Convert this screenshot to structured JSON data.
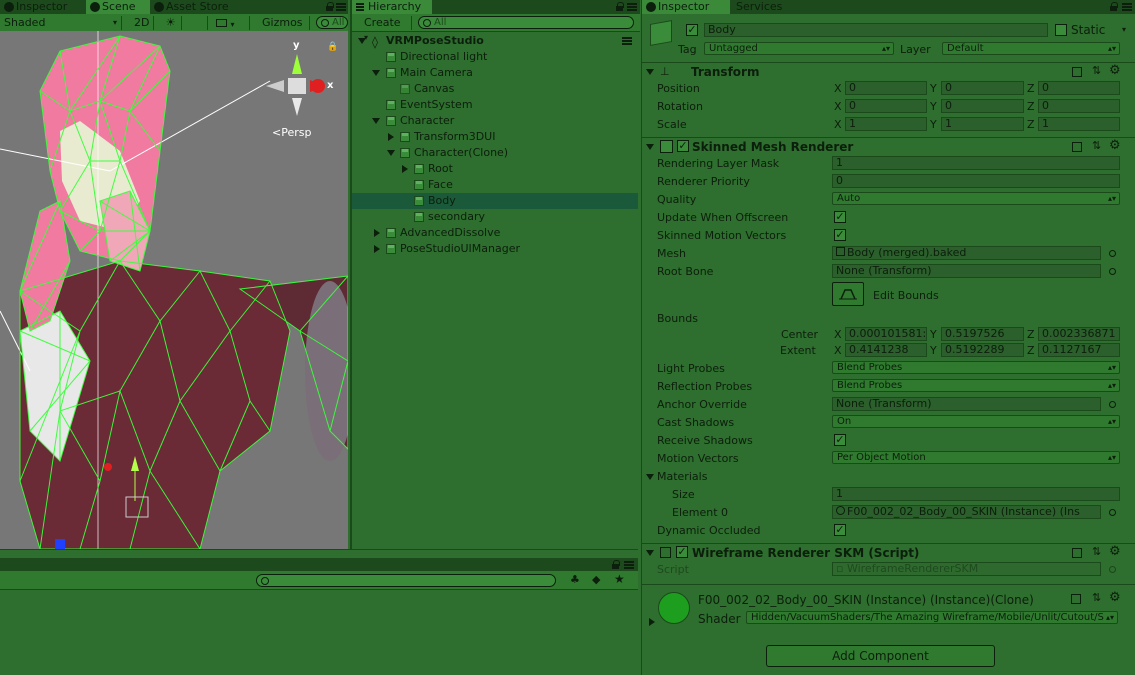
{
  "scene_panel": {
    "tabs": [
      {
        "label": "Inspector"
      },
      {
        "label": "Scene"
      },
      {
        "label": "Asset Store"
      }
    ],
    "toolbar": {
      "shading_mode": "Shaded",
      "mode_2d": "2D",
      "gizmos": "Gizmos",
      "search_placeholder": "All"
    },
    "gizmo": {
      "y_label": "y",
      "x_label": "x",
      "projection": "Persp"
    }
  },
  "hierarchy": {
    "tab_label": "Hierarchy",
    "create_label": "Create",
    "search_placeholder": "All",
    "scene_name": "VRMPoseStudio",
    "items": [
      {
        "label": "Directional light"
      },
      {
        "label": "Main Camera"
      },
      {
        "label": "Canvas"
      },
      {
        "label": "EventSystem"
      },
      {
        "label": "Character"
      },
      {
        "label": "Transform3DUI"
      },
      {
        "label": "Character(Clone)"
      },
      {
        "label": "Root"
      },
      {
        "label": "Face"
      },
      {
        "label": "Body"
      },
      {
        "label": "secondary"
      },
      {
        "label": "AdvancedDissolve"
      },
      {
        "label": "PoseStudioUIManager"
      }
    ]
  },
  "inspector": {
    "tabs": [
      {
        "label": "Inspector"
      },
      {
        "label": "Services"
      }
    ],
    "object_name": "Body",
    "static_label": "Static",
    "tag_label": "Tag",
    "tag_value": "Untagged",
    "layer_label": "Layer",
    "layer_value": "Default",
    "transform": {
      "title": "Transform",
      "position_label": "Position",
      "rotation_label": "Rotation",
      "scale_label": "Scale",
      "position": {
        "x": "0",
        "y": "0",
        "z": "0"
      },
      "rotation": {
        "x": "0",
        "y": "0",
        "z": "0"
      },
      "scale": {
        "x": "1",
        "y": "1",
        "z": "1"
      }
    },
    "axis": {
      "x": "X",
      "y": "Y",
      "z": "Z"
    },
    "smr": {
      "title": "Skinned Mesh Renderer",
      "rendering_layer_mask_label": "Rendering Layer Mask",
      "rendering_layer_mask": "1",
      "renderer_priority_label": "Renderer Priority",
      "renderer_priority": "0",
      "quality_label": "Quality",
      "quality": "Auto",
      "update_offscreen_label": "Update When Offscreen",
      "skinned_motion_label": "Skinned Motion Vectors",
      "mesh_label": "Mesh",
      "mesh": "Body (merged).baked",
      "root_bone_label": "Root Bone",
      "root_bone": "None (Transform)",
      "edit_bounds": "Edit Bounds",
      "bounds_label": "Bounds",
      "center_label": "Center",
      "extent_label": "Extent",
      "center": {
        "x": "0.000101581:",
        "y": "0.5197526",
        "z": "0.002336871"
      },
      "extent": {
        "x": "0.4141238",
        "y": "0.5192289",
        "z": "0.1127167"
      },
      "light_probes_label": "Light Probes",
      "light_probes": "Blend Probes",
      "reflection_probes_label": "Reflection Probes",
      "reflection_probes": "Blend Probes",
      "anchor_override_label": "Anchor Override",
      "anchor_override": "None (Transform)",
      "cast_shadows_label": "Cast Shadows",
      "cast_shadows": "On",
      "receive_shadows_label": "Receive Shadows",
      "motion_vectors_label": "Motion Vectors",
      "motion_vectors": "Per Object Motion",
      "materials_label": "Materials",
      "size_label": "Size",
      "size": "1",
      "element0_label": "Element 0",
      "element0": "F00_002_02_Body_00_SKIN (Instance) (Ins",
      "dynamic_occluded_label": "Dynamic Occluded"
    },
    "wireframe": {
      "title": "Wireframe Renderer SKM (Script)",
      "script_label": "Script",
      "script_value": "WireframeRendererSKM"
    },
    "material": {
      "name": "F00_002_02_Body_00_SKIN (Instance) (Instance)(Clone)",
      "shader_label": "Shader",
      "shader": "Hidden/VacuumShaders/The Amazing Wireframe/Mobile/Unlit/Cutout/S"
    },
    "add_component": "Add Component"
  },
  "colors": {
    "panel_bg": "#2e6e2e",
    "text": "#0c1f0c",
    "selection": "#1a5a3a",
    "wire": "#39ff39",
    "material_swatch": "#1e9e1e"
  }
}
